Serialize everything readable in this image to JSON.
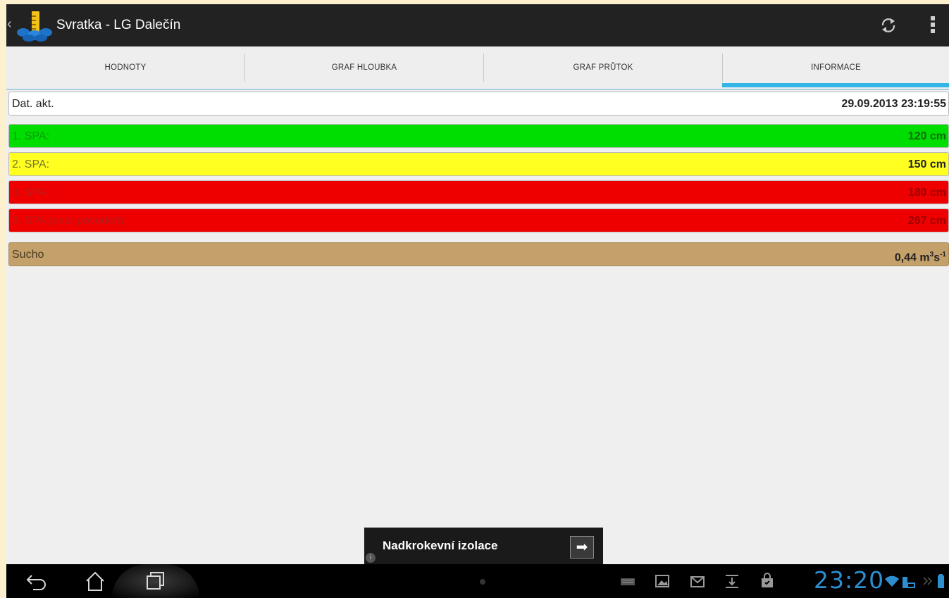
{
  "app": {
    "title": "Svratka - LG Dalečín"
  },
  "tabs": [
    {
      "label": "HODNOTY"
    },
    {
      "label": "GRAF HLOUBKA"
    },
    {
      "label": "GRAF PRŮTOK"
    },
    {
      "label": "INFORMACE",
      "selected": true
    }
  ],
  "info": {
    "date": {
      "label": "Dat. akt.",
      "value": "29.09.2013 23:19:55"
    },
    "spa1": {
      "label": "1. SPA:",
      "value": "120 cm",
      "color": "#00dd00"
    },
    "spa2": {
      "label": "2. SPA:",
      "value": "150 cm",
      "color": "#ffff22"
    },
    "spa3": {
      "label": "3. SPA:",
      "value": "180 cm",
      "color": "#ee0000"
    },
    "spa3x": {
      "label": "3. SPA (extr. povodeň):",
      "value": "267 cm",
      "color": "#ee0000"
    },
    "sucho": {
      "label": "Sucho",
      "value": "0,44 m",
      "unit_exp1": "3",
      "unit_mid": "s",
      "unit_exp2": "-1",
      "color": "#c4a06a"
    }
  },
  "ad": {
    "text": "Nadkrokevní izolace",
    "arrow": "➡",
    "info_glyph": "i"
  },
  "statusbar": {
    "clock": "23:20"
  },
  "icons": {
    "back_nav": "back-arrow-icon",
    "home": "home-icon",
    "recent": "recent-apps-icon",
    "refresh": "refresh-icon",
    "overflow": "overflow-menu-icon"
  },
  "colors": {
    "accent": "#33b5e5",
    "actionbar": "#222222"
  }
}
